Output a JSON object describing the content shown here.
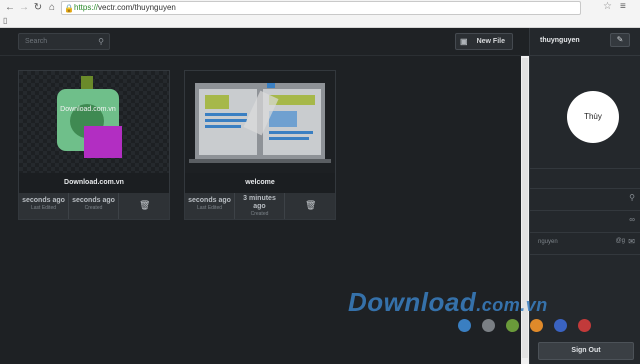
{
  "browser": {
    "url_scheme": "https://",
    "url_rest": "vectr.com/thuynguyen"
  },
  "topbar": {
    "search_placeholder": "Search",
    "new_file_label": "New File"
  },
  "cards": [
    {
      "title": "Download.com.vn",
      "thumb_text": "Download.com.vn",
      "last_edited_value": "seconds ago",
      "last_edited_label": "Last Edited",
      "created_value": "seconds ago",
      "created_label": "Created"
    },
    {
      "title": "welcome",
      "last_edited_value": "seconds ago",
      "last_edited_label": "Last Edited",
      "created_value_line1": "3 minutes",
      "created_value_line2": "ago",
      "created_label": "Created"
    }
  ],
  "profile": {
    "username": "thuynguyen",
    "avatar_name": "Thùy",
    "handle": "nguyen",
    "handle_suffix": "@g",
    "sign_out_label": "Sign Out"
  },
  "watermark": {
    "text_main": "Download",
    "text_tail": ".com.vn",
    "dot_colors": [
      "#3a7fc2",
      "#7a7f84",
      "#6a9a3a",
      "#e08a2a",
      "#3a63c2",
      "#c23a3a"
    ]
  },
  "icons": {
    "back": "arrow-left-icon",
    "forward": "arrow-right-icon",
    "reload": "reload-icon",
    "home": "home-icon",
    "lock": "lock-icon",
    "star": "star-icon",
    "menu": "hamburger-menu-icon",
    "search": "search-icon",
    "new_file": "new-file-icon",
    "edit": "edit-icon",
    "trash": "trash-icon",
    "location": "location-icon",
    "link": "link-icon",
    "mail": "mail-icon"
  }
}
